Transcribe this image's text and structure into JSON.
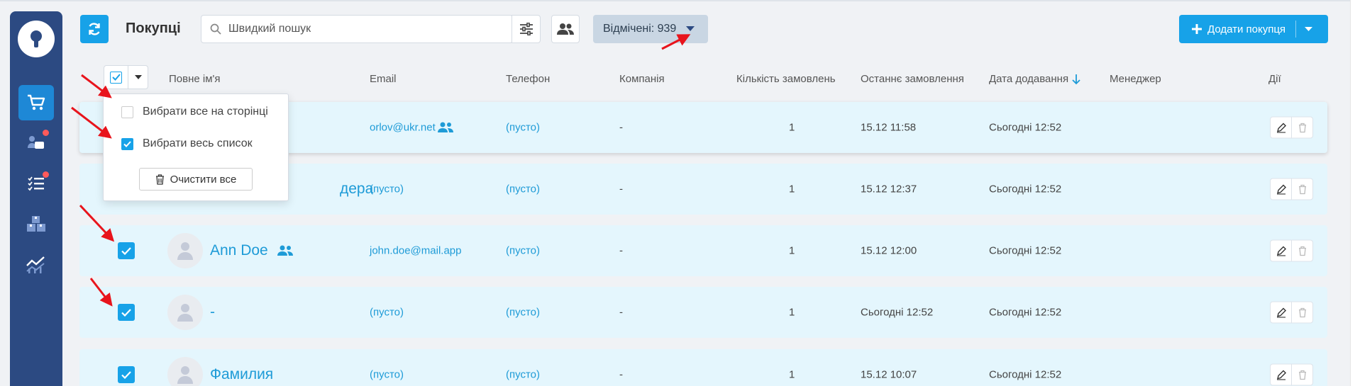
{
  "header": {
    "title": "Покупці",
    "search_placeholder": "Швидкий пошук",
    "selected_label": "Відмічені: 939",
    "add_button_label": "Додати покупця"
  },
  "sidebar": {
    "items": [
      {
        "icon": "logo-icon"
      },
      {
        "icon": "cart-icon",
        "active": true
      },
      {
        "icon": "chat-icon",
        "badge": true
      },
      {
        "icon": "tasks-icon",
        "badge": true
      },
      {
        "icon": "boxes-icon"
      },
      {
        "icon": "analytics-icon"
      }
    ]
  },
  "table": {
    "columns": {
      "name": "Повне ім'я",
      "email": "Email",
      "phone": "Телефон",
      "company": "Компанія",
      "orders": "Кількість замовлень",
      "last_order": "Останнє замовлення",
      "date_added": "Дата додавання",
      "manager": "Менеджер",
      "actions": "Дії"
    },
    "rows": [
      {
        "name": "",
        "email": "orlov@ukr.net",
        "phone": "(пусто)",
        "company": "-",
        "orders": "1",
        "last_order": "15.12 11:58",
        "date_added": "Сьогодні 12:52",
        "checked": true
      },
      {
        "name": "дера",
        "email": "(пусто)",
        "phone": "(пусто)",
        "company": "-",
        "orders": "1",
        "last_order": "15.12 12:37",
        "date_added": "Сьогодні 12:52",
        "checked": true
      },
      {
        "name": "Ann Doe",
        "email": "john.doe@mail.app",
        "phone": "(пусто)",
        "company": "-",
        "orders": "1",
        "last_order": "15.12 12:00",
        "date_added": "Сьогодні 12:52",
        "checked": true
      },
      {
        "name": "-",
        "email": "(пусто)",
        "phone": "(пусто)",
        "company": "-",
        "orders": "1",
        "last_order": "Сьогодні 12:52",
        "date_added": "Сьогодні 12:52",
        "checked": true
      },
      {
        "name": "Фамилия",
        "email": "(пусто)",
        "phone": "(пусто)",
        "company": "-",
        "orders": "1",
        "last_order": "15.12 10:07",
        "date_added": "Сьогодні 12:52",
        "checked": true
      }
    ]
  },
  "dropdown": {
    "select_page": "Вибрати все на сторінці",
    "select_all": "Вибрати весь список",
    "clear": "Очистити все"
  },
  "colors": {
    "sidebar": "#2c4a82",
    "accent": "#17a2e8",
    "row_bg": "#e4f6fd",
    "arrow": "#e8141c"
  }
}
